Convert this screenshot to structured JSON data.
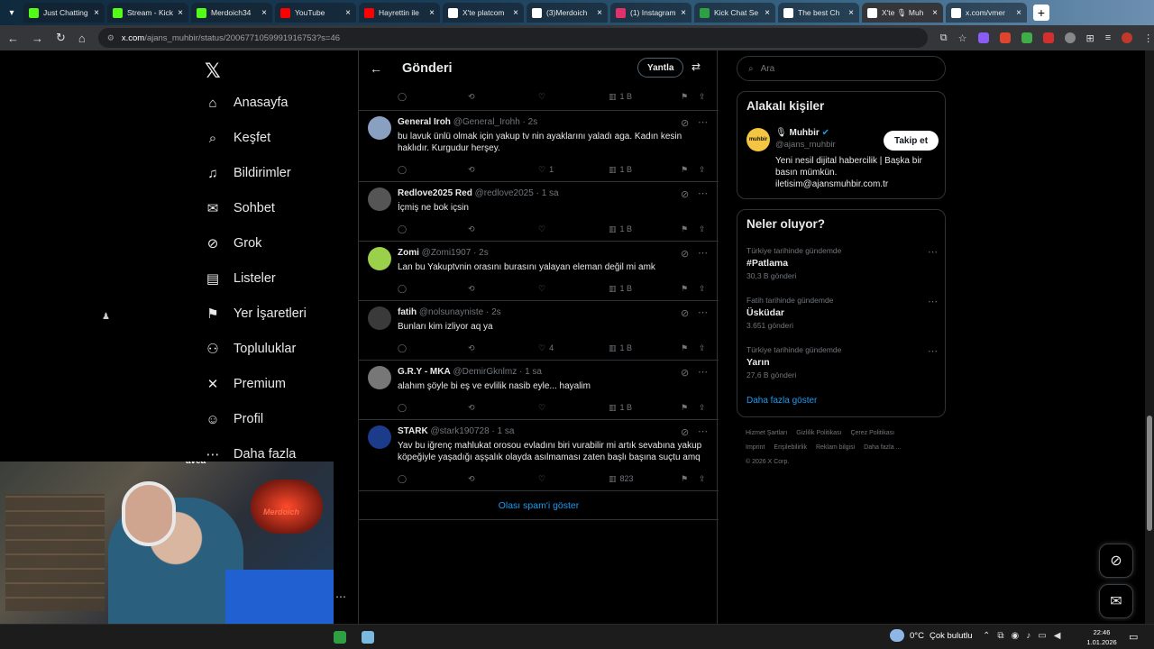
{
  "browser": {
    "tabs": [
      {
        "title": "Just Chatting",
        "color": "#53fc18"
      },
      {
        "title": "Stream - Kick",
        "color": "#53fc18"
      },
      {
        "title": "Merdoich34",
        "color": "#53fc18"
      },
      {
        "title": "YouTube",
        "color": "#ff0000"
      },
      {
        "title": "Hayrettin ile",
        "color": "#ff0000"
      },
      {
        "title": "X'te platcom",
        "color": "#ffffff"
      },
      {
        "title": "(3)Merdoich",
        "color": "#ffffff"
      },
      {
        "title": "(1) Instagram",
        "color": "#e1306c"
      },
      {
        "title": "Kick Chat Se",
        "color": "#2ea043"
      },
      {
        "title": "The best Ch",
        "color": "#ffffff"
      },
      {
        "title": "X'te 🎙 Muh",
        "color": "#ffffff"
      },
      {
        "title": "x.com/vmer",
        "color": "#ffffff"
      }
    ],
    "url_host": "x.com",
    "url_path": "/ajans_muhbir/status/2006771059991916753?s=46"
  },
  "nav": {
    "items": [
      {
        "label": "Anasayfa",
        "icon": "home-icon",
        "glyph": "⌂"
      },
      {
        "label": "Keşfet",
        "icon": "search-icon",
        "glyph": "⌕"
      },
      {
        "label": "Bildirimler",
        "icon": "bell-icon",
        "glyph": "♫"
      },
      {
        "label": "Sohbet",
        "icon": "mail-icon",
        "glyph": "✉"
      },
      {
        "label": "Grok",
        "icon": "grok-icon",
        "glyph": "⊘"
      },
      {
        "label": "Listeler",
        "icon": "list-icon",
        "glyph": "▤"
      },
      {
        "label": "Yer İşaretleri",
        "icon": "bookmark-icon",
        "glyph": "⚑"
      },
      {
        "label": "Topluluklar",
        "icon": "communities-icon",
        "glyph": "⚇"
      },
      {
        "label": "Premium",
        "icon": "x-premium-icon",
        "glyph": "✕"
      },
      {
        "label": "Profil",
        "icon": "profile-icon",
        "glyph": "☺"
      },
      {
        "label": "Daha fazla",
        "icon": "more-circle-icon",
        "glyph": "⋯"
      }
    ]
  },
  "main": {
    "title": "Gönderi",
    "reply_label": "Yantla",
    "first_views": "1 B",
    "tweets": [
      {
        "name": "General Iroh",
        "handle": "@General_Irohh · 2s",
        "text": "bu lavuk ünlü olmak için yakup tv nin ayaklarını yaladı aga. Kadın kesin haklıdır. Kurgudur herşey.",
        "likes": "1",
        "views": "1 B",
        "avatar": "#8aa0c0"
      },
      {
        "name": "Redlove2025 Red",
        "handle": "@redlove2025 · 1 sa",
        "text": "İçmiş ne bok içsin",
        "likes": "",
        "views": "1 B",
        "avatar": "#555555"
      },
      {
        "name": "Zomi",
        "handle": "@Zomi1907 · 2s",
        "text": "Lan bu Yakuptvnin orasını burasını yalayan eleman değil mi amk",
        "likes": "",
        "views": "1 B",
        "avatar": "#9ad04a"
      },
      {
        "name": "fatih",
        "handle": "@nolsunayniste · 2s",
        "text": "Bunları kim izliyor aq ya",
        "likes": "4",
        "views": "1 B",
        "avatar": "#3a3a3a"
      },
      {
        "name": "G.R.Y - MKA",
        "handle": "@DemirGknlmz · 1 sa",
        "text": "alahım şöyle bi eş ve evlilik nasib eyle... hayalim",
        "likes": "",
        "views": "1 B",
        "avatar": "#777777"
      },
      {
        "name": "STARK",
        "handle": "@stark190728 · 1 sa",
        "text": "Yav bu iğrenç mahlukat orosou evladını biri vurabilir mi artık sevabına yakup köpeğiyle yaşadığı aşşalık olayda asılmaması zaten başlı başına suçtu amq",
        "likes": "",
        "views": "823",
        "avatar": "#1c3b8a"
      }
    ],
    "spam_label": "Olası spam'i göster"
  },
  "right": {
    "search_placeholder": "Ara",
    "related_title": "Alakalı kişiler",
    "person": {
      "name": "Muhbir",
      "handle": "@ajans_muhbir",
      "bio": "Yeni nesil dijital habercilik | Başka bir basın mümkün. iletisim@ajansmuhbir.com.tr",
      "follow_label": "Takip et",
      "avatar_text": "muhbir"
    },
    "trends_title": "Neler oluyor?",
    "trends": [
      {
        "context": "Türkiye tarihinde gündemde",
        "name": "#Patlama",
        "count": "30,3 B gönderi"
      },
      {
        "context": "Fatih tarihinde gündemde",
        "name": "Üsküdar",
        "count": "3.651 gönderi"
      },
      {
        "context": "Türkiye tarihinde gündemde",
        "name": "Yarın",
        "count": "27,6 B gönderi"
      }
    ],
    "show_more": "Daha fazla göster",
    "footer_links": [
      "Hizmet Şartları",
      "Gizlilik Politikası",
      "Çerez Politikası",
      "Imprint",
      "Erişilebilirlik",
      "Reklam bilgisi",
      "Daha fazla ..."
    ],
    "copyright": "© 2026 X Corp."
  },
  "webcam": {
    "sign_text": "Merdoich",
    "shirt_text": "avea"
  },
  "taskbar": {
    "temp": "0°C",
    "weather": "Çok bulutlu",
    "time": "22:46",
    "date": "1.01.2026"
  }
}
